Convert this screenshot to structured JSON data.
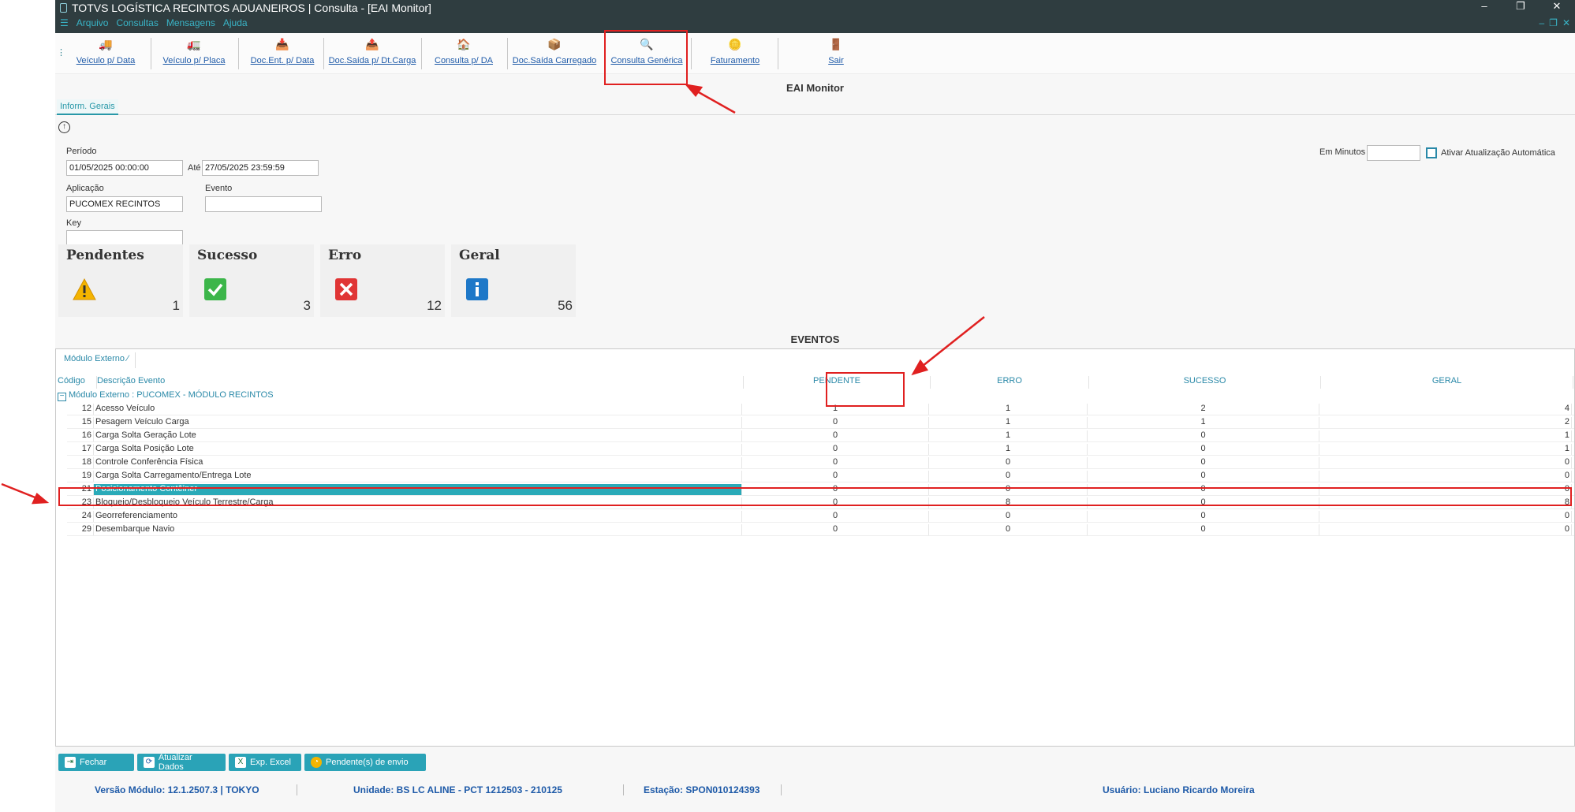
{
  "window": {
    "title": "TOTVS LOGÍSTICA RECINTOS ADUANEIROS | Consulta - [EAI Monitor]",
    "menu": [
      "Arquivo",
      "Consultas",
      "Mensagens",
      "Ajuda"
    ]
  },
  "toolbar": {
    "items": [
      {
        "label": "Veículo p/ Data",
        "icon": "truck-calendar-icon"
      },
      {
        "label": "Veículo p/ Placa",
        "icon": "truck-plate-icon"
      },
      {
        "label": "Doc.Ent. p/ Data",
        "icon": "document-in-icon"
      },
      {
        "label": "Doc.Saída p/ Dt.Carga",
        "icon": "document-out-icon"
      },
      {
        "label": "Consulta p/ DA",
        "icon": "house-search-icon"
      },
      {
        "label": "Doc.Saída Carregado",
        "icon": "document-loaded-icon"
      },
      {
        "label": "Consulta Genérica",
        "icon": "magnifier-icon"
      },
      {
        "label": "Faturamento",
        "icon": "coin-icon"
      },
      {
        "label": "Sair",
        "icon": "exit-door-icon"
      }
    ]
  },
  "page": {
    "title": "EAI Monitor",
    "tab": "Inform. Gerais"
  },
  "filters": {
    "periodo_label": "Período",
    "periodo_from": "01/05/2025 00:00:00",
    "ate_label": "Até",
    "periodo_to": "27/05/2025 23:59:59",
    "aplicacao_label": "Aplicação",
    "aplicacao_value": "PUCOMEX RECINTOS",
    "evento_label": "Evento",
    "evento_value": "",
    "key_label": "Key",
    "key_value": "",
    "minutos_label": "Em Minutos",
    "minutos_value": "",
    "auto_label": "Ativar Atualização Automática"
  },
  "cards": [
    {
      "title": "Pendentes",
      "value": "1",
      "icon": "warning-icon"
    },
    {
      "title": "Sucesso",
      "value": "3",
      "icon": "check-icon"
    },
    {
      "title": "Erro",
      "value": "12",
      "icon": "error-x-icon"
    },
    {
      "title": "Geral",
      "value": "56",
      "icon": "info-icon"
    }
  ],
  "eventos": {
    "title": "EVENTOS",
    "group_chip": "Módulo Externo",
    "columns": {
      "codigo": "Código",
      "descricao": "Descrição Evento",
      "pendente": "PENDENTE",
      "erro": "ERRO",
      "sucesso": "SUCESSO",
      "geral": "GERAL"
    },
    "group_row": "Módulo Externo : PUCOMEX - MÓDULO RECINTOS",
    "rows": [
      {
        "codigo": "12",
        "descricao": "Acesso Veículo",
        "pendente": "1",
        "erro": "1",
        "sucesso": "2",
        "geral": "4"
      },
      {
        "codigo": "15",
        "descricao": "Pesagem Veículo Carga",
        "pendente": "0",
        "erro": "1",
        "sucesso": "1",
        "geral": "2"
      },
      {
        "codigo": "16",
        "descricao": "Carga Solta Geração Lote",
        "pendente": "0",
        "erro": "1",
        "sucesso": "0",
        "geral": "1"
      },
      {
        "codigo": "17",
        "descricao": "Carga Solta Posição Lote",
        "pendente": "0",
        "erro": "1",
        "sucesso": "0",
        "geral": "1"
      },
      {
        "codigo": "18",
        "descricao": "Controle Conferência Física",
        "pendente": "0",
        "erro": "0",
        "sucesso": "0",
        "geral": "0"
      },
      {
        "codigo": "19",
        "descricao": "Carga Solta Carregamento/Entrega Lote",
        "pendente": "0",
        "erro": "0",
        "sucesso": "0",
        "geral": "0"
      },
      {
        "codigo": "21",
        "descricao": "Posicionamento Contêiner",
        "pendente": "0",
        "erro": "0",
        "sucesso": "0",
        "geral": "0"
      },
      {
        "codigo": "23",
        "descricao": "Bloqueio/Desbloqueio Veículo Terrestre/Carga",
        "pendente": "0",
        "erro": "8",
        "sucesso": "0",
        "geral": "8"
      },
      {
        "codigo": "24",
        "descricao": "Georreferenciamento",
        "pendente": "0",
        "erro": "0",
        "sucesso": "0",
        "geral": "0"
      },
      {
        "codigo": "29",
        "descricao": "Desembarque Navio",
        "pendente": "0",
        "erro": "0",
        "sucesso": "0",
        "geral": "0"
      }
    ]
  },
  "buttons": {
    "fechar": "Fechar",
    "atualizar": "Atualizar Dados",
    "excel": "Exp. Excel",
    "pendentes": "Pendente(s) de envio"
  },
  "status": {
    "versao": "Versão Módulo:  12.1.2507.3  |  TOKYO",
    "unidade": "Unidade: BS LC ALINE - PCT 1212503 - 210125",
    "estacao": "Estação: SPON010124393",
    "usuario": "Usuário: Luciano Ricardo Moreira"
  },
  "colors": {
    "accent": "#2aa3b7",
    "titlebar": "#2f3d40",
    "annotation": "#e02020"
  }
}
